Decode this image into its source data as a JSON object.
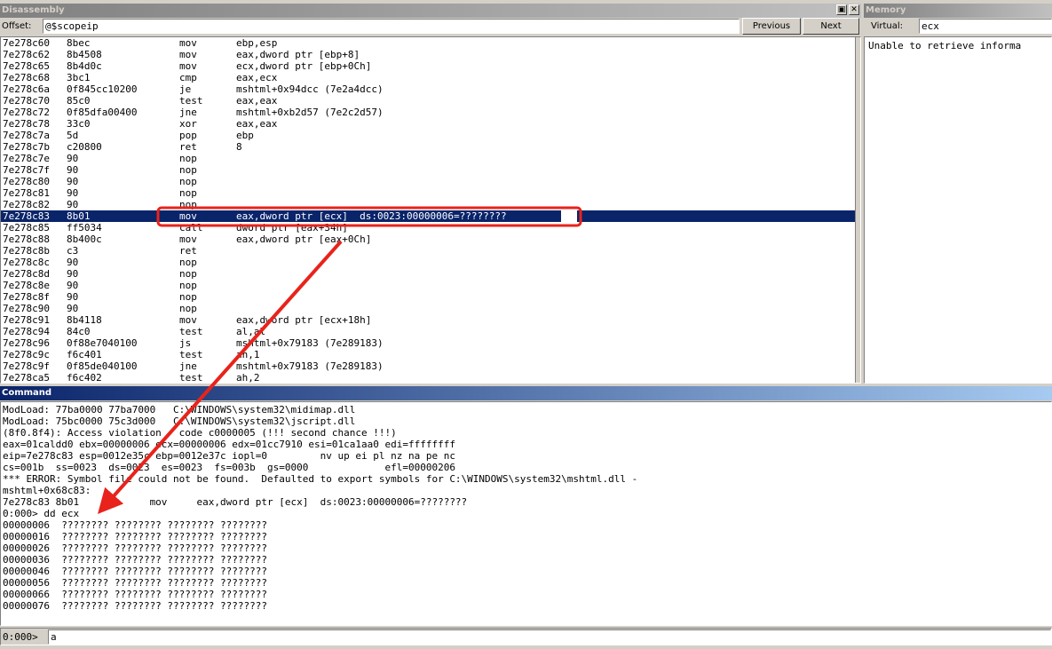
{
  "disassembly": {
    "title": "Disassembly",
    "offset_label": "Offset:",
    "offset_value": "@$scopeip",
    "previous_label": "Previous",
    "next_label": "Next",
    "lines": [
      {
        "addr": "7e278c60",
        "bytes": "8bec",
        "mn": "mov",
        "op": "ebp,esp"
      },
      {
        "addr": "7e278c62",
        "bytes": "8b4508",
        "mn": "mov",
        "op": "eax,dword ptr [ebp+8]"
      },
      {
        "addr": "7e278c65",
        "bytes": "8b4d0c",
        "mn": "mov",
        "op": "ecx,dword ptr [ebp+0Ch]"
      },
      {
        "addr": "7e278c68",
        "bytes": "3bc1",
        "mn": "cmp",
        "op": "eax,ecx"
      },
      {
        "addr": "7e278c6a",
        "bytes": "0f845cc10200",
        "mn": "je",
        "op": "mshtml+0x94dcc (7e2a4dcc)"
      },
      {
        "addr": "7e278c70",
        "bytes": "85c0",
        "mn": "test",
        "op": "eax,eax"
      },
      {
        "addr": "7e278c72",
        "bytes": "0f85dfa00400",
        "mn": "jne",
        "op": "mshtml+0xb2d57 (7e2c2d57)"
      },
      {
        "addr": "7e278c78",
        "bytes": "33c0",
        "mn": "xor",
        "op": "eax,eax"
      },
      {
        "addr": "7e278c7a",
        "bytes": "5d",
        "mn": "pop",
        "op": "ebp"
      },
      {
        "addr": "7e278c7b",
        "bytes": "c20800",
        "mn": "ret",
        "op": "8"
      },
      {
        "addr": "7e278c7e",
        "bytes": "90",
        "mn": "nop",
        "op": ""
      },
      {
        "addr": "7e278c7f",
        "bytes": "90",
        "mn": "nop",
        "op": ""
      },
      {
        "addr": "7e278c80",
        "bytes": "90",
        "mn": "nop",
        "op": ""
      },
      {
        "addr": "7e278c81",
        "bytes": "90",
        "mn": "nop",
        "op": ""
      },
      {
        "addr": "7e278c82",
        "bytes": "90",
        "mn": "nop",
        "op": ""
      },
      {
        "addr": "7e278c83",
        "bytes": "8b01",
        "mn": "mov",
        "op": "eax,dword ptr [ecx]  ds:0023:00000006=????????"
      },
      {
        "addr": "7e278c85",
        "bytes": "ff5034",
        "mn": "call",
        "op": "dword ptr [eax+34h]"
      },
      {
        "addr": "7e278c88",
        "bytes": "8b400c",
        "mn": "mov",
        "op": "eax,dword ptr [eax+0Ch]"
      },
      {
        "addr": "7e278c8b",
        "bytes": "c3",
        "mn": "ret",
        "op": ""
      },
      {
        "addr": "7e278c8c",
        "bytes": "90",
        "mn": "nop",
        "op": ""
      },
      {
        "addr": "7e278c8d",
        "bytes": "90",
        "mn": "nop",
        "op": ""
      },
      {
        "addr": "7e278c8e",
        "bytes": "90",
        "mn": "nop",
        "op": ""
      },
      {
        "addr": "7e278c8f",
        "bytes": "90",
        "mn": "nop",
        "op": ""
      },
      {
        "addr": "7e278c90",
        "bytes": "90",
        "mn": "nop",
        "op": ""
      },
      {
        "addr": "7e278c91",
        "bytes": "8b4118",
        "mn": "mov",
        "op": "eax,dword ptr [ecx+18h]"
      },
      {
        "addr": "7e278c94",
        "bytes": "84c0",
        "mn": "test",
        "op": "al,al"
      },
      {
        "addr": "7e278c96",
        "bytes": "0f88e7040100",
        "mn": "js",
        "op": "mshtml+0x79183 (7e289183)"
      },
      {
        "addr": "7e278c9c",
        "bytes": "f6c401",
        "mn": "test",
        "op": "ah,1"
      },
      {
        "addr": "7e278c9f",
        "bytes": "0f85de040100",
        "mn": "jne",
        "op": "mshtml+0x79183 (7e289183)"
      },
      {
        "addr": "7e278ca5",
        "bytes": "f6c402",
        "mn": "test",
        "op": "ah,2"
      }
    ]
  },
  "memory": {
    "title": "Memory",
    "virtual_label": "Virtual:",
    "virtual_value": "ecx",
    "message": "Unable to retrieve informa"
  },
  "command": {
    "title": "Command",
    "lines": [
      "ModLoad: 77ba0000 77ba7000   C:\\WINDOWS\\system32\\midimap.dll",
      "ModLoad: 75bc0000 75c3d000   C:\\WINDOWS\\system32\\jscript.dll",
      "(8f0.8f4): Access violation - code c0000005 (!!! second chance !!!)",
      "eax=01caldd0 ebx=00000006 ecx=00000006 edx=01cc7910 esi=01ca1aa0 edi=ffffffff",
      "eip=7e278c83 esp=0012e35c ebp=0012e37c iopl=0         nv up ei pl nz na pe nc",
      "cs=001b  ss=0023  ds=0023  es=0023  fs=003b  gs=0000             efl=00000206",
      "*** ERROR: Symbol file could not be found.  Defaulted to export symbols for C:\\WINDOWS\\system32\\mshtml.dll -",
      "mshtml+0x68c83:",
      "7e278c83 8b01            mov     eax,dword ptr [ecx]  ds:0023:00000006=????????",
      "0:000> dd ecx",
      "00000006  ???????? ???????? ???????? ????????",
      "00000016  ???????? ???????? ???????? ????????",
      "00000026  ???????? ???????? ???????? ????????",
      "00000036  ???????? ???????? ???????? ????????",
      "00000046  ???????? ???????? ???????? ????????",
      "00000056  ???????? ???????? ???????? ????????",
      "00000066  ???????? ???????? ???????? ????????",
      "00000076  ???????? ???????? ???????? ????????"
    ],
    "prompt": "0:000>",
    "input_value": "a"
  },
  "colors": {
    "highlight": "#0a246a",
    "annotation": "#e8231b"
  }
}
